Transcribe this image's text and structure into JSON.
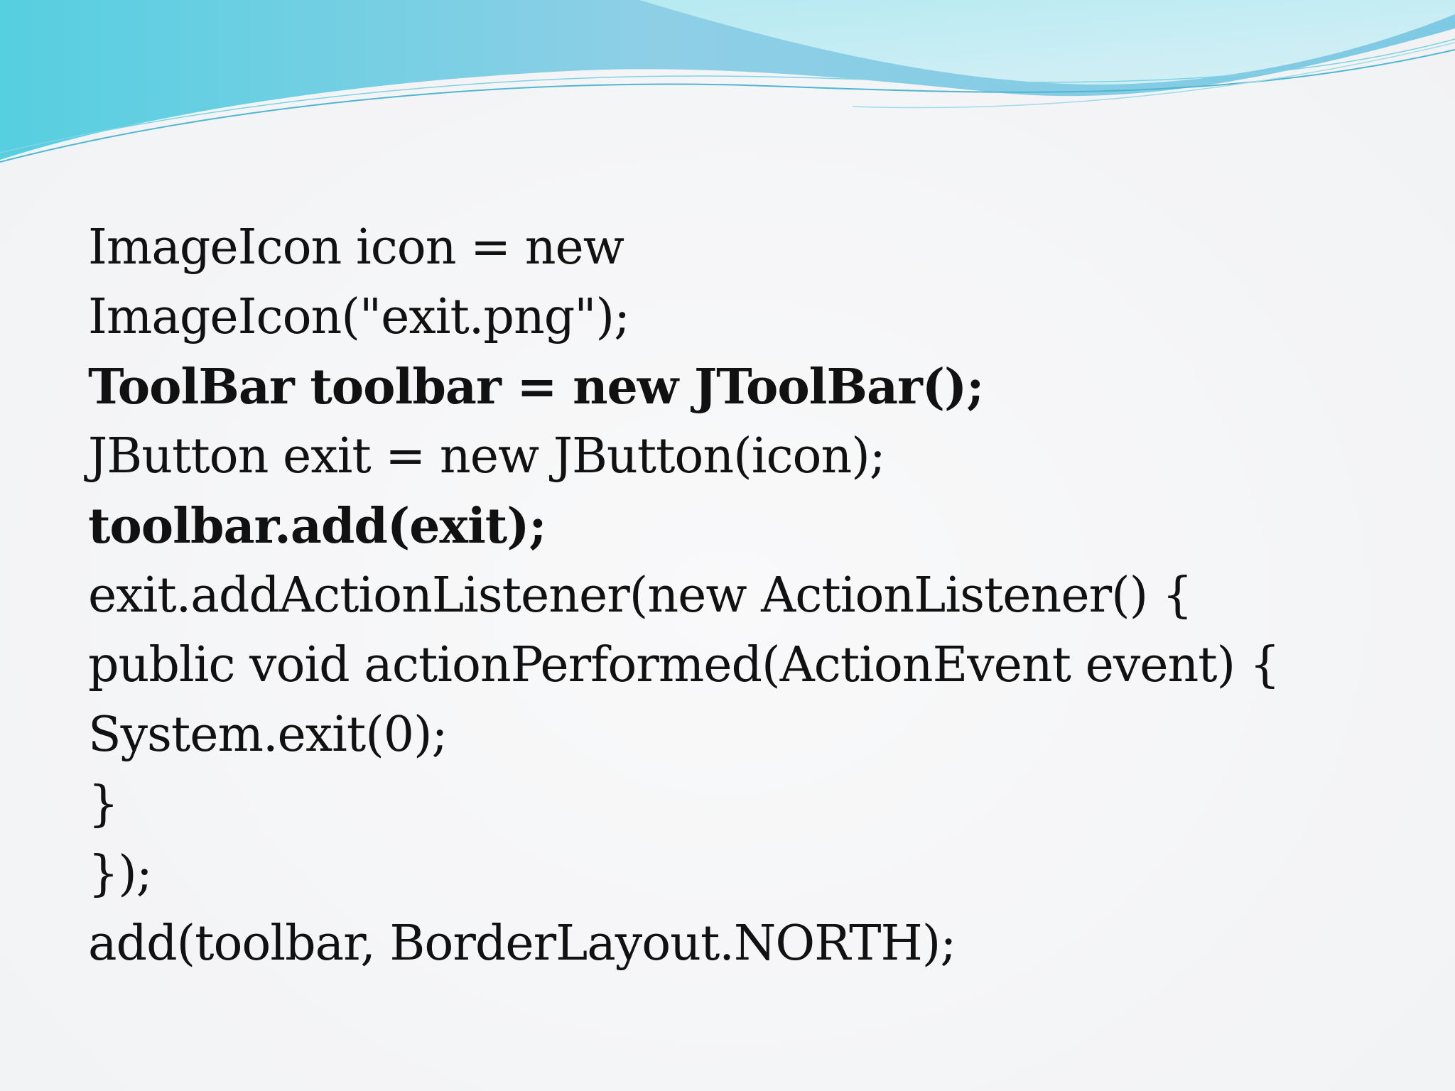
{
  "slide": {
    "code_lines": [
      {
        "text": "ImageIcon icon = new",
        "bold": false
      },
      {
        "text": "ImageIcon(\"exit.png\");",
        "bold": false
      },
      {
        "text": "ToolBar toolbar = new JToolBar();",
        "bold": true
      },
      {
        "text": "JButton exit = new JButton(icon);",
        "bold": false
      },
      {
        "text": "toolbar.add(exit);",
        "bold": true
      },
      {
        "text": "exit.addActionListener(new ActionListener() {",
        "bold": false
      },
      {
        "text": "public void actionPerformed(ActionEvent event) {",
        "bold": false
      },
      {
        "text": "System.exit(0);",
        "bold": false
      },
      {
        "text": "}",
        "bold": false
      },
      {
        "text": "});",
        "bold": false
      },
      {
        "text": "add(toolbar, BorderLayout.NORTH);",
        "bold": false
      }
    ]
  },
  "theme": {
    "background": "#f3f4f6",
    "wave_dark": "#5bc0dc",
    "wave_light": "#a8e4ef",
    "text_color": "#111111"
  }
}
